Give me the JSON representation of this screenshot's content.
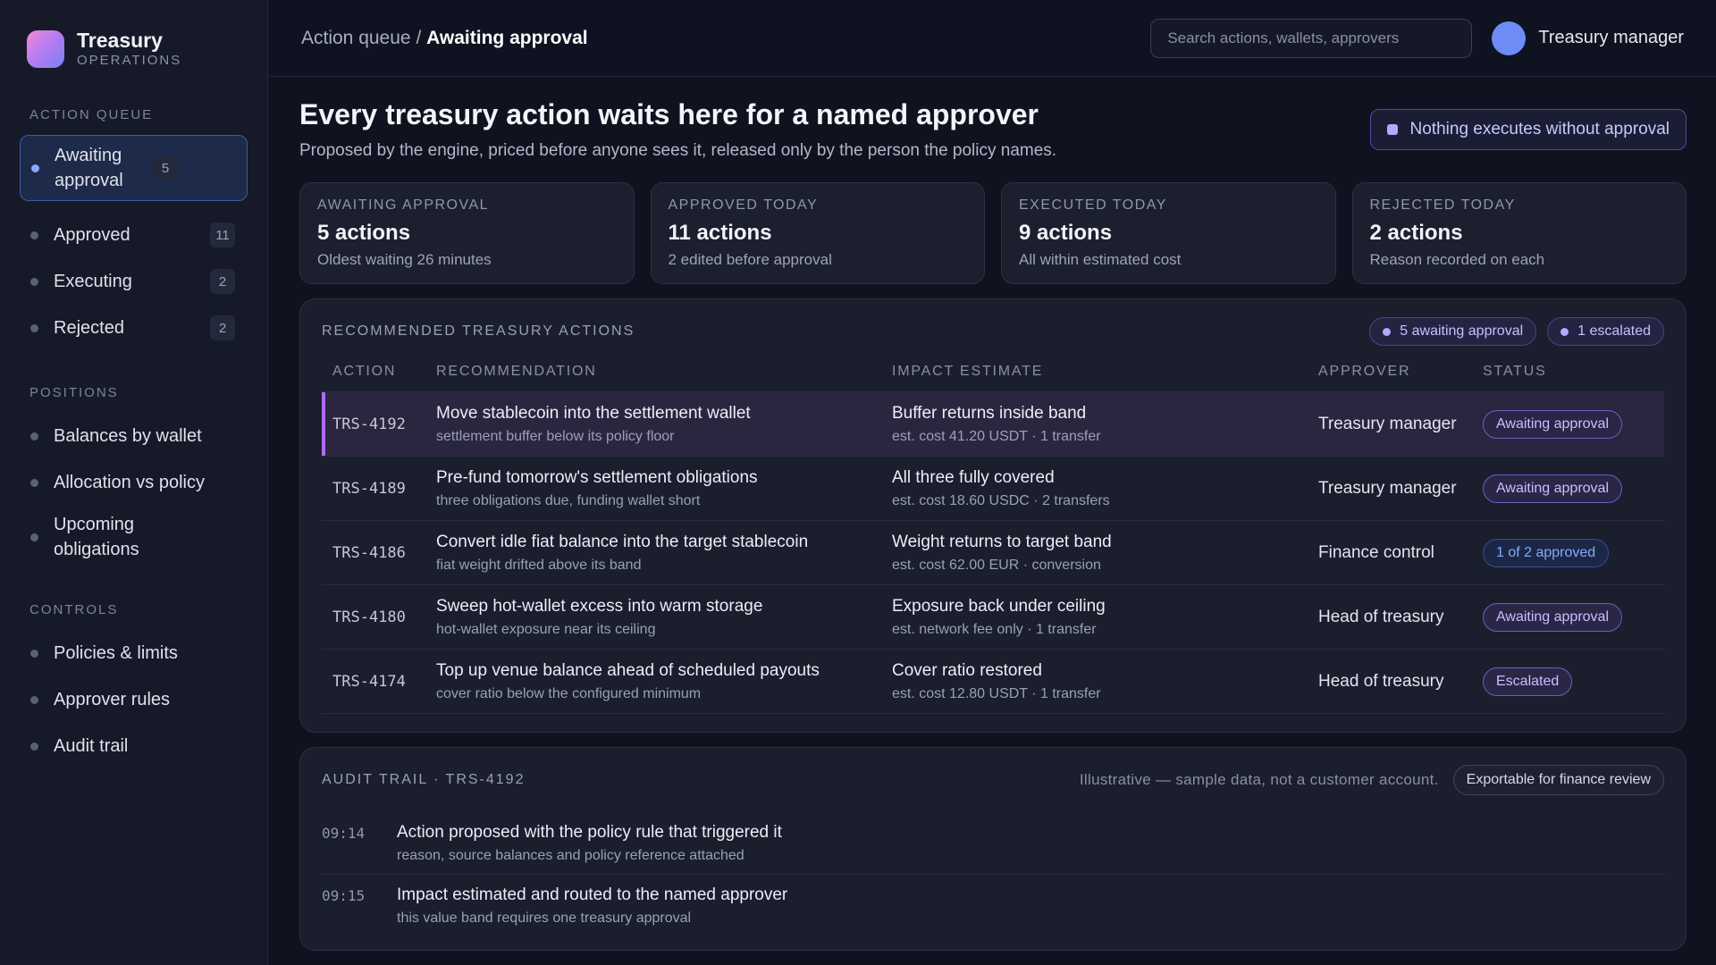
{
  "brand": {
    "name": "Treasury",
    "sub": "OPERATIONS"
  },
  "sidebar": {
    "groups": [
      {
        "heading": "ACTION QUEUE",
        "items": [
          {
            "label": "Awaiting approval",
            "count": "5",
            "active": true
          },
          {
            "label": "Approved",
            "count": "11"
          },
          {
            "label": "Executing",
            "count": "2"
          },
          {
            "label": "Rejected",
            "count": "2"
          }
        ]
      },
      {
        "heading": "POSITIONS",
        "items": [
          {
            "label": "Balances by wallet"
          },
          {
            "label": "Allocation vs policy"
          },
          {
            "label": "Upcoming obligations"
          }
        ]
      },
      {
        "heading": "CONTROLS",
        "items": [
          {
            "label": "Policies & limits"
          },
          {
            "label": "Approver rules"
          },
          {
            "label": "Audit trail"
          }
        ]
      }
    ]
  },
  "topbar": {
    "breadcrumb_parent": "Action queue",
    "breadcrumb_sep": " / ",
    "breadcrumb_current": "Awaiting approval",
    "search_placeholder": "Search actions, wallets, approvers",
    "user_name": "Treasury manager"
  },
  "header": {
    "title": "Every treasury action waits here for a named approver",
    "subtitle": "Proposed by the engine, priced before anyone sees it, released only by the person the policy names.",
    "policy_pill": "Nothing executes without approval"
  },
  "stats": [
    {
      "label": "AWAITING APPROVAL",
      "value": "5 actions",
      "note": "Oldest waiting 26 minutes"
    },
    {
      "label": "APPROVED TODAY",
      "value": "11 actions",
      "note": "2 edited before approval"
    },
    {
      "label": "EXECUTED TODAY",
      "value": "9 actions",
      "note": "All within estimated cost"
    },
    {
      "label": "REJECTED TODAY",
      "value": "2 actions",
      "note": "Reason recorded on each"
    }
  ],
  "recommended": {
    "title": "RECOMMENDED TREASURY ACTIONS",
    "chips": [
      "5 awaiting approval",
      "1 escalated"
    ],
    "columns": [
      "ACTION",
      "RECOMMENDATION",
      "IMPACT ESTIMATE",
      "APPROVER",
      "STATUS"
    ],
    "rows": [
      {
        "id": "TRS-4192",
        "rec": "Move stablecoin into the settlement wallet",
        "rec_sub": "settlement buffer below its policy floor",
        "impact": "Buffer returns inside band",
        "impact_sub": "est. cost 41.20 USDT · 1 transfer",
        "approver": "Treasury manager",
        "status": "Awaiting approval",
        "tone": "purple",
        "selected": true
      },
      {
        "id": "TRS-4189",
        "rec": "Pre-fund tomorrow's settlement obligations",
        "rec_sub": "three obligations due, funding wallet short",
        "impact": "All three fully covered",
        "impact_sub": "est. cost 18.60 USDC · 2 transfers",
        "approver": "Treasury manager",
        "status": "Awaiting approval",
        "tone": "purple"
      },
      {
        "id": "TRS-4186",
        "rec": "Convert idle fiat balance into the target stablecoin",
        "rec_sub": "fiat weight drifted above its band",
        "impact": "Weight returns to target band",
        "impact_sub": "est. cost 62.00 EUR · conversion",
        "approver": "Finance control",
        "status": "1 of 2 approved",
        "tone": "blue"
      },
      {
        "id": "TRS-4180",
        "rec": "Sweep hot-wallet excess into warm storage",
        "rec_sub": "hot-wallet exposure near its ceiling",
        "impact": "Exposure back under ceiling",
        "impact_sub": "est. network fee only · 1 transfer",
        "approver": "Head of treasury",
        "status": "Awaiting approval",
        "tone": "purple"
      },
      {
        "id": "TRS-4174",
        "rec": "Top up venue balance ahead of scheduled payouts",
        "rec_sub": "cover ratio below the configured minimum",
        "impact": "Cover ratio restored",
        "impact_sub": "est. cost 12.80 USDT · 1 transfer",
        "approver": "Head of treasury",
        "status": "Escalated",
        "tone": "purple"
      }
    ]
  },
  "audit": {
    "title": "AUDIT TRAIL · TRS-4192",
    "note": "Illustrative — sample data, not a customer account.",
    "export_label": "Exportable for finance review",
    "entries": [
      {
        "time": "09:14",
        "text": "Action proposed with the policy rule that triggered it",
        "sub": "reason, source balances and policy reference attached"
      },
      {
        "time": "09:15",
        "text": "Impact estimated and routed to the named approver",
        "sub": "this value band requires one treasury approval"
      }
    ]
  },
  "colors": {
    "accent": "#b06cf0",
    "status_purple": "#6b5fbf",
    "status_blue": "#34508f",
    "avatar": "#6d8cf5"
  }
}
